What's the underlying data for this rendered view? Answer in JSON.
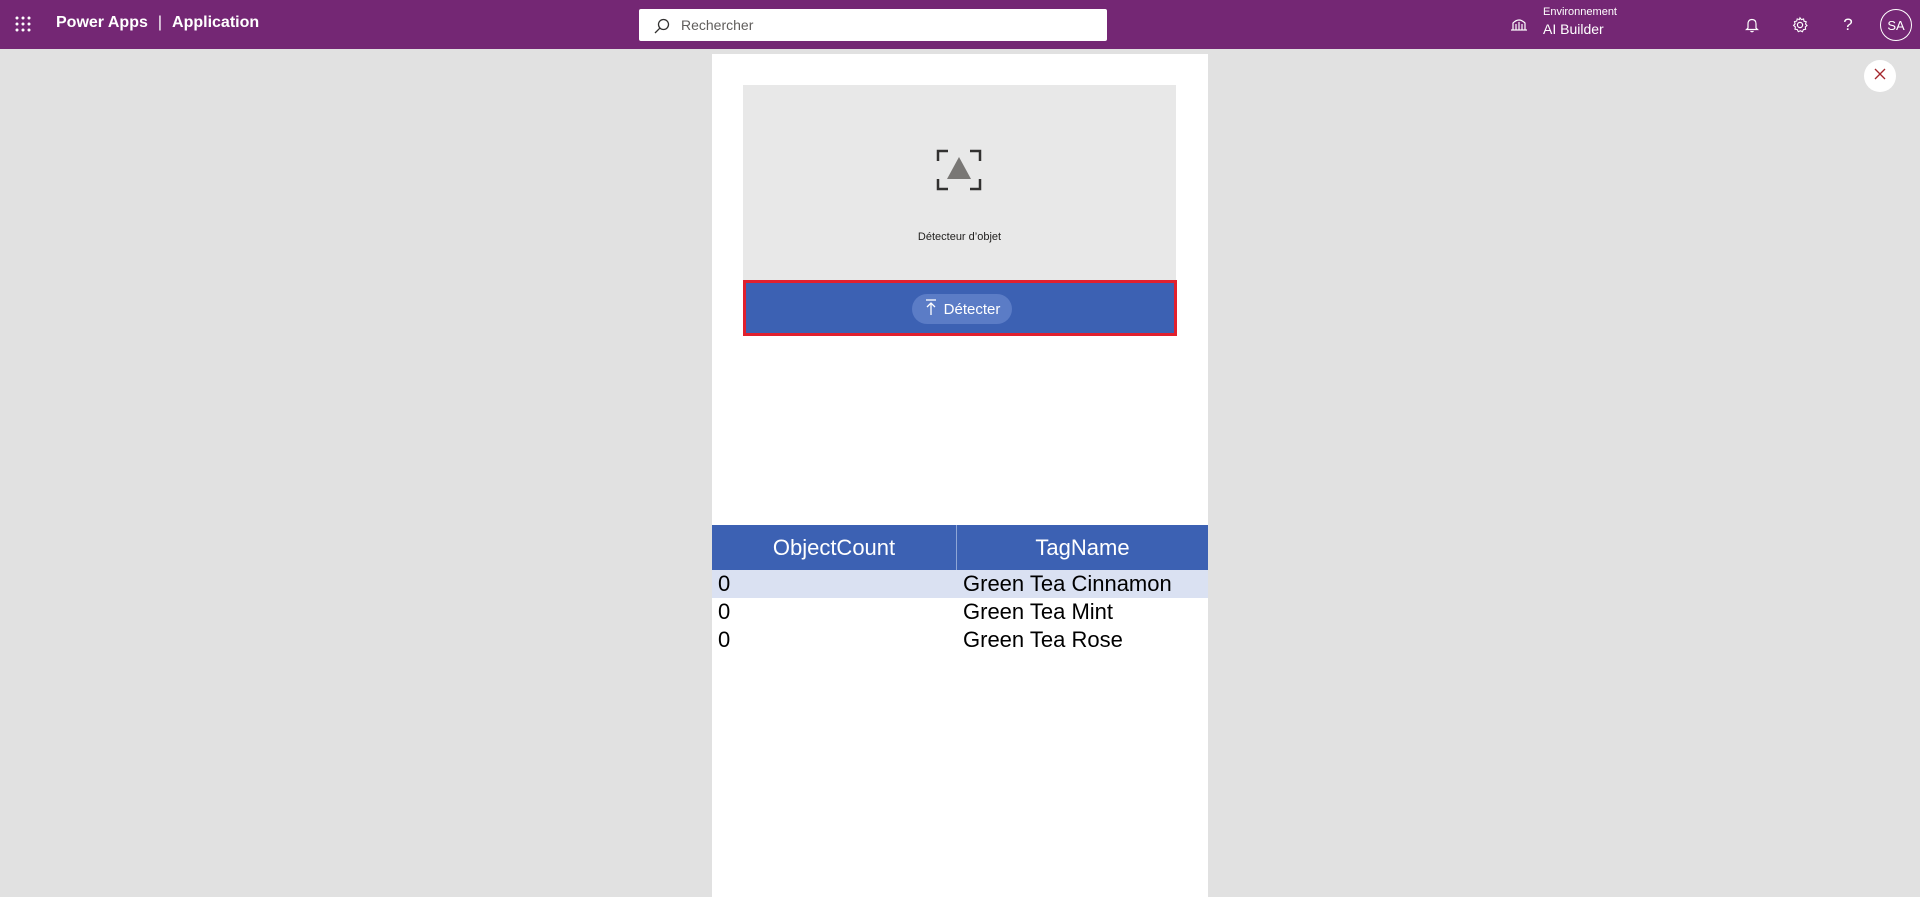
{
  "header": {
    "app_name": "Power Apps",
    "separator": "|",
    "section": "Application",
    "search_placeholder": "Rechercher",
    "environment_label": "Environnement",
    "environment_name": "AI Builder",
    "avatar_initials": "SA",
    "icons": [
      "app-launcher-icon",
      "search-icon",
      "environment-icon",
      "bell-icon",
      "gear-icon",
      "help-icon",
      "close-icon"
    ]
  },
  "detector": {
    "label": "Détecteur d’objet",
    "button_label": "Détecter"
  },
  "grid": {
    "columns": [
      "ObjectCount",
      "TagName"
    ],
    "rows": [
      {
        "count": "0",
        "tag": "Green Tea Cinnamon"
      },
      {
        "count": "0",
        "tag": "Green Tea Mint"
      },
      {
        "count": "0",
        "tag": "Green Tea Rose"
      }
    ]
  },
  "colors": {
    "header_bg": "#742774",
    "accent_blue": "#3c61b3",
    "highlight_border": "#e0202e",
    "selected_row": "#dae1f2"
  }
}
